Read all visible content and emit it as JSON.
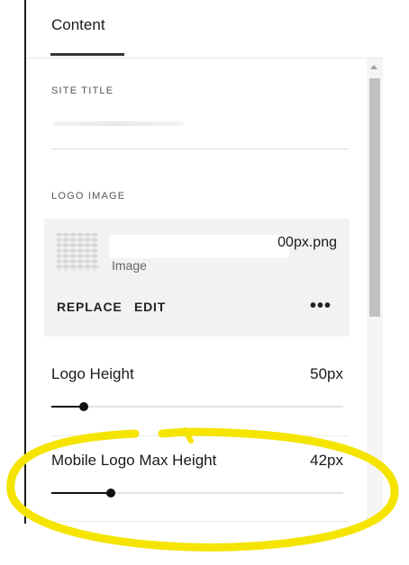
{
  "tabs": {
    "content_label": "Content"
  },
  "site_title": {
    "label": "SITE TITLE",
    "value": ""
  },
  "logo_image": {
    "label": "LOGO IMAGE",
    "filename": "00px.png",
    "type_label": "Image",
    "replace_label": "REPLACE",
    "edit_label": "EDIT",
    "more_label": "•••"
  },
  "logo_height": {
    "label": "Logo Height",
    "value": "50px",
    "level": 0.11
  },
  "mobile_logo_max_height": {
    "label": "Mobile Logo Max Height",
    "value": "42px",
    "level": 0.205
  },
  "colors": {
    "annotation": "#f5e400",
    "text": "#1a1a1a",
    "card_bg": "#f2f2f2"
  }
}
